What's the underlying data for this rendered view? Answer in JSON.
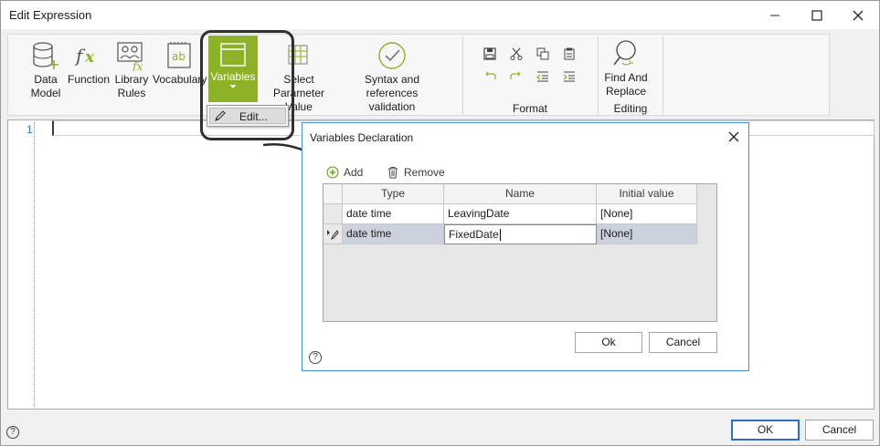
{
  "window": {
    "title": "Edit Expression"
  },
  "ribbon": {
    "buttons": [
      {
        "label": "Data\nModel"
      },
      {
        "label": "Function"
      },
      {
        "label": "Library\nRules"
      },
      {
        "label": "Vocabulary"
      },
      {
        "label": "Variables"
      },
      {
        "label": "Select Parameter\nValue"
      },
      {
        "label": "Syntax and references\nvalidation"
      },
      {
        "label": "Find And\nReplace"
      }
    ],
    "groups": {
      "format": "Format",
      "editing": "Editing"
    },
    "variables_menu": {
      "edit": "Edit..."
    }
  },
  "editor": {
    "line_number": "1"
  },
  "dialog": {
    "title": "Variables Declaration",
    "toolbar": {
      "add": "Add",
      "remove": "Remove"
    },
    "columns": [
      "Type",
      "Name",
      "Initial value"
    ],
    "rows": [
      {
        "type": "date time",
        "name": "LeavingDate",
        "initial": "[None]"
      },
      {
        "type": "date time",
        "name": "FixedDate",
        "initial": "[None]"
      }
    ],
    "ok": "Ok",
    "cancel": "Cancel"
  },
  "footer": {
    "ok": "OK",
    "cancel": "Cancel"
  },
  "help": "?",
  "colors": {
    "accent": "#8db228",
    "dialog_border": "#3f8fd9",
    "selected_row": "#ccd2dd"
  }
}
